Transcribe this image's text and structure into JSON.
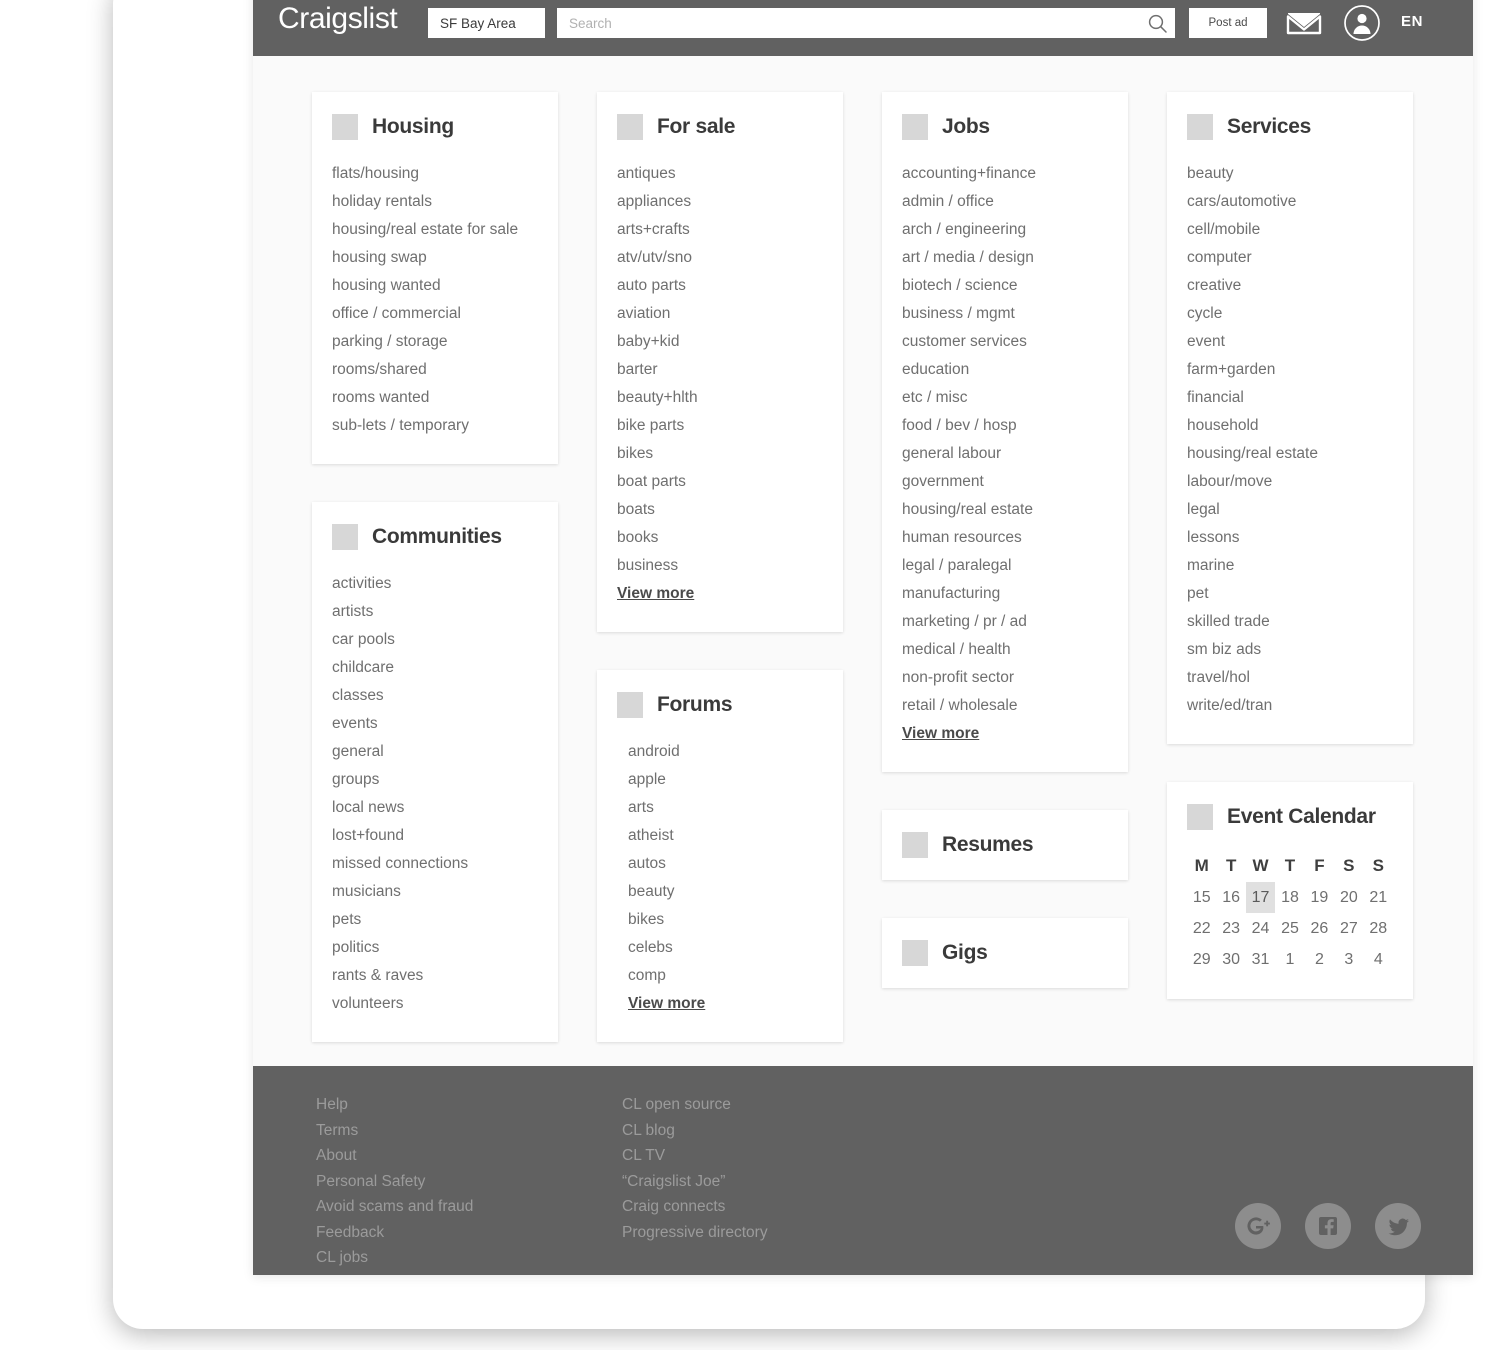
{
  "header": {
    "brand": "Craigslist",
    "location": "SF Bay Area",
    "search_placeholder": "Search",
    "search_value": "",
    "post_ad": "Post ad",
    "language": "EN",
    "icons": {
      "search": "search-icon",
      "mail": "envelope-icon",
      "account": "user-avatar-icon"
    }
  },
  "colors": {
    "header_bar": "#616161",
    "footer_bar": "#616161",
    "page_bg": "#fafafa",
    "card_bg": "#ffffff",
    "placeholder_square": "#d7d7d7",
    "body_text": "#6f6f6f",
    "title_text": "#3a3a3a",
    "footer_link": "#9b9b9b",
    "calendar_selected": "#e0e0e0",
    "social_circle": "#8d8d8d"
  },
  "view_more_label": "View more",
  "cards": {
    "housing": {
      "title": "Housing",
      "items": [
        "flats/housing",
        "holiday rentals",
        "housing/real estate for sale",
        "housing swap",
        "housing wanted",
        "office / commercial",
        "parking / storage",
        "rooms/shared",
        "rooms wanted",
        "sub-lets / temporary"
      ]
    },
    "communities": {
      "title": "Communities",
      "items": [
        "activities",
        "artists",
        "car pools",
        "childcare",
        "classes",
        "events",
        "general",
        "groups",
        "local news",
        "lost+found",
        "missed connections",
        "musicians",
        "pets",
        "politics",
        "rants & raves",
        "volunteers"
      ]
    },
    "for_sale": {
      "title": "For sale",
      "items": [
        "antiques",
        "appliances",
        "arts+crafts",
        "atv/utv/sno",
        "auto parts",
        "aviation",
        "baby+kid",
        "barter",
        "beauty+hlth",
        "bike parts",
        "bikes",
        "boat parts",
        "boats",
        "books",
        "business"
      ],
      "view_more": "View more"
    },
    "forums": {
      "title": "Forums",
      "items": [
        "android",
        "apple",
        "arts",
        "atheist",
        "autos",
        "beauty",
        "bikes",
        "celebs",
        "comp"
      ],
      "view_more": "View more"
    },
    "jobs": {
      "title": "Jobs",
      "items": [
        "accounting+finance",
        "admin / office",
        "arch / engineering",
        "art / media / design",
        "biotech / science",
        "business / mgmt",
        "customer services",
        "education",
        "etc / misc",
        "food / bev / hosp",
        "general labour",
        "government",
        "housing/real estate",
        "human resources",
        "legal / paralegal",
        "manufacturing",
        "marketing / pr / ad",
        "medical / health",
        "non-profit sector",
        "retail / wholesale"
      ],
      "view_more": "View more"
    },
    "resumes": {
      "title": "Resumes"
    },
    "gigs": {
      "title": "Gigs"
    },
    "services": {
      "title": "Services",
      "items": [
        "beauty",
        "cars/automotive",
        "cell/mobile",
        "computer",
        "creative",
        "cycle",
        "event",
        "farm+garden",
        "financial",
        "household",
        "housing/real estate",
        "labour/move",
        "legal",
        "lessons",
        "marine",
        "pet",
        "skilled trade",
        "sm biz ads",
        "travel/hol",
        "write/ed/tran"
      ]
    },
    "event_calendar": {
      "title": "Event Calendar",
      "weekdays": [
        "M",
        "T",
        "W",
        "T",
        "F",
        "S",
        "S"
      ],
      "weeks": [
        [
          "15",
          "16",
          "17",
          "18",
          "19",
          "20",
          "21"
        ],
        [
          "22",
          "23",
          "24",
          "25",
          "26",
          "27",
          "28"
        ],
        [
          "29",
          "30",
          "31",
          "1",
          "2",
          "3",
          "4"
        ]
      ],
      "selected_day": "17"
    }
  },
  "footer": {
    "column_1": [
      "Help",
      "Terms",
      "About",
      "Personal Safety",
      "Avoid scams and fraud",
      "Feedback",
      "CL jobs"
    ],
    "column_2": [
      "CL open source",
      "CL blog",
      "CL TV",
      "“Craigslist Joe”",
      "Craig connects",
      "Progressive directory"
    ],
    "socials": [
      "google-plus-icon",
      "facebook-icon",
      "twitter-icon"
    ]
  }
}
